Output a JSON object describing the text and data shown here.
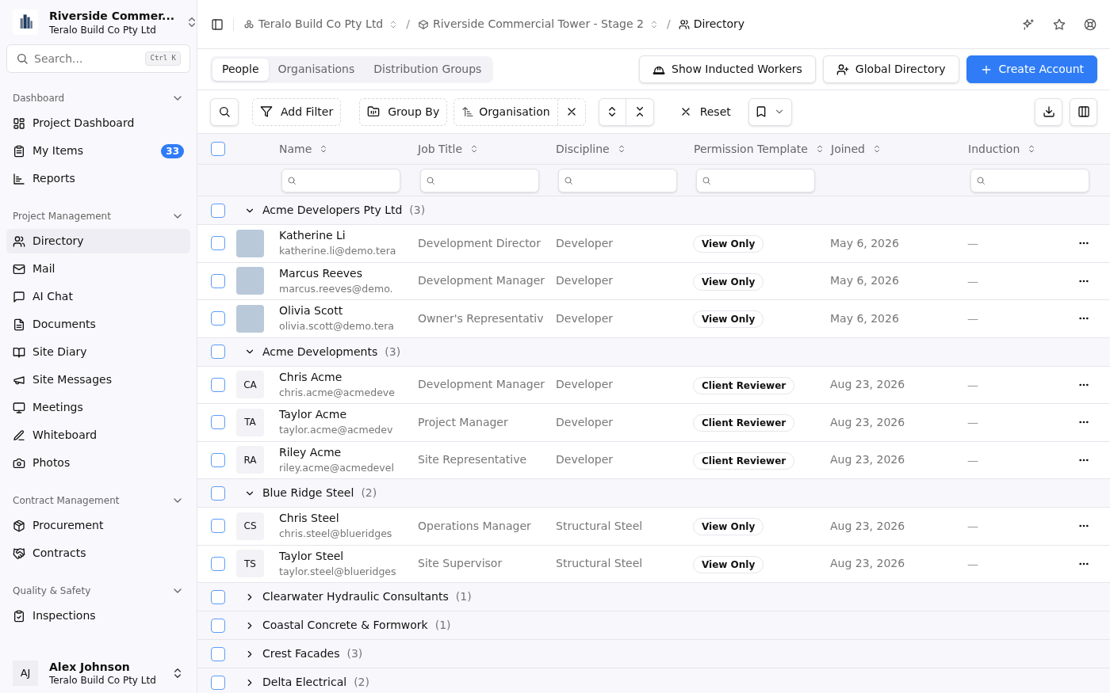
{
  "sidebar": {
    "project": {
      "name": "Riverside Commer...",
      "org": "Teralo Build Co Pty Ltd"
    },
    "search": {
      "placeholder": "Search...",
      "shortcut": "Ctrl K"
    },
    "sections": [
      {
        "title": "Dashboard",
        "expanded": true,
        "items": [
          {
            "label": "Project Dashboard",
            "selected": false
          },
          {
            "label": "My Items",
            "selected": false,
            "badge": "33"
          },
          {
            "label": "Reports",
            "selected": false
          }
        ]
      },
      {
        "title": "Project Management",
        "expanded": true,
        "items": [
          {
            "label": "Directory",
            "selected": true
          },
          {
            "label": "Mail",
            "selected": false
          },
          {
            "label": "AI Chat",
            "selected": false
          },
          {
            "label": "Documents",
            "selected": false
          },
          {
            "label": "Site Diary",
            "selected": false
          },
          {
            "label": "Site Messages",
            "selected": false
          },
          {
            "label": "Meetings",
            "selected": false
          },
          {
            "label": "Whiteboard",
            "selected": false
          },
          {
            "label": "Photos",
            "selected": false
          }
        ]
      },
      {
        "title": "Contract Management",
        "expanded": true,
        "items": [
          {
            "label": "Procurement",
            "selected": false
          },
          {
            "label": "Contracts",
            "selected": false
          }
        ]
      },
      {
        "title": "Quality & Safety",
        "expanded": true,
        "items": [
          {
            "label": "Inspections",
            "selected": false
          }
        ]
      }
    ],
    "user": {
      "initials": "AJ",
      "name": "Alex Johnson",
      "org": "Teralo Build Co Pty Ltd"
    }
  },
  "breadcrumbs": [
    {
      "label": "Teralo Build Co Pty Ltd",
      "switcher": true
    },
    {
      "separator": "/",
      "label": "Riverside Commercial Tower - Stage 2",
      "switcher": true
    },
    {
      "separator": "/",
      "label": "Directory",
      "switcher": false
    }
  ],
  "tabs": [
    {
      "label": "People",
      "selected": true
    },
    {
      "label": "Organisations",
      "selected": false
    },
    {
      "label": "Distribution Groups",
      "selected": false
    }
  ],
  "actions": [
    {
      "label": "Show Inducted Workers",
      "kind": "outline"
    },
    {
      "label": "Global Directory",
      "kind": "outline"
    },
    {
      "label": "Create Account",
      "kind": "primary"
    }
  ],
  "toolbar": {
    "add_filter": "Add Filter",
    "group_by": "Group By",
    "group_chip": "Organisation",
    "reset": "Reset"
  },
  "table": {
    "select_all_checked": false,
    "columns": [
      {
        "label": "Name",
        "filter": true
      },
      {
        "label": "Job Title",
        "filter": true
      },
      {
        "label": "Discipline",
        "filter": true
      },
      {
        "label": "Permission Template",
        "filter": true
      },
      {
        "label": "Joined",
        "filter": false
      },
      {
        "label": "Induction",
        "filter": true
      }
    ],
    "groups": [
      {
        "name": "Acme Developers Pty Ltd",
        "count": "(3)",
        "expanded": true,
        "checked": false,
        "rows": [
          {
            "kind": "photo",
            "name": "Katherine Li",
            "email": "katherine.li@demo.tera",
            "job_title": "Development Director",
            "discipline": "Developer",
            "permission": "View Only",
            "joined": "May 6, 2026",
            "induction": "—",
            "checked": false
          },
          {
            "kind": "photo",
            "name": "Marcus Reeves",
            "email": "marcus.reeves@demo.",
            "job_title": "Development Manager",
            "discipline": "Developer",
            "permission": "View Only",
            "joined": "May 6, 2026",
            "induction": "—",
            "checked": false
          },
          {
            "kind": "photo",
            "name": "Olivia Scott",
            "email": "olivia.scott@demo.tera",
            "job_title": "Owner's Representativ",
            "discipline": "Developer",
            "permission": "View Only",
            "joined": "May 6, 2026",
            "induction": "—",
            "checked": false
          }
        ]
      },
      {
        "name": "Acme Developments",
        "count": "(3)",
        "expanded": true,
        "checked": false,
        "rows": [
          {
            "kind": "initials",
            "initials": "CA",
            "name": "Chris Acme",
            "email": "chris.acme@acmedeve",
            "job_title": "Development Manager",
            "discipline": "Developer",
            "permission": "Client Reviewer",
            "joined": "Aug 23, 2026",
            "induction": "—",
            "checked": false
          },
          {
            "kind": "initials",
            "initials": "TA",
            "name": "Taylor Acme",
            "email": "taylor.acme@acmedev",
            "job_title": "Project Manager",
            "discipline": "Developer",
            "permission": "Client Reviewer",
            "joined": "Aug 23, 2026",
            "induction": "—",
            "checked": false
          },
          {
            "kind": "initials",
            "initials": "RA",
            "name": "Riley Acme",
            "email": "riley.acme@acmedevel",
            "job_title": "Site Representative",
            "discipline": "Developer",
            "permission": "Client Reviewer",
            "joined": "Aug 23, 2026",
            "induction": "—",
            "checked": false
          }
        ]
      },
      {
        "name": "Blue Ridge Steel",
        "count": "(2)",
        "expanded": true,
        "checked": false,
        "rows": [
          {
            "kind": "initials",
            "initials": "CS",
            "name": "Chris Steel",
            "email": "chris.steel@blueridges",
            "job_title": "Operations Manager",
            "discipline": "Structural Steel",
            "permission": "View Only",
            "joined": "Aug 23, 2026",
            "induction": "—",
            "checked": false
          },
          {
            "kind": "initials",
            "initials": "TS",
            "name": "Taylor Steel",
            "email": "taylor.steel@blueridges",
            "job_title": "Site Supervisor",
            "discipline": "Structural Steel",
            "permission": "View Only",
            "joined": "Aug 23, 2026",
            "induction": "—",
            "checked": false
          }
        ]
      },
      {
        "name": "Clearwater Hydraulic Consultants",
        "count": "(1)",
        "expanded": false,
        "checked": false
      },
      {
        "name": "Coastal Concrete & Formwork",
        "count": "(1)",
        "expanded": false,
        "checked": false
      },
      {
        "name": "Crest Facades",
        "count": "(3)",
        "expanded": false,
        "checked": false
      },
      {
        "name": "Delta Electrical",
        "count": "(2)",
        "expanded": false,
        "checked": false
      }
    ]
  }
}
